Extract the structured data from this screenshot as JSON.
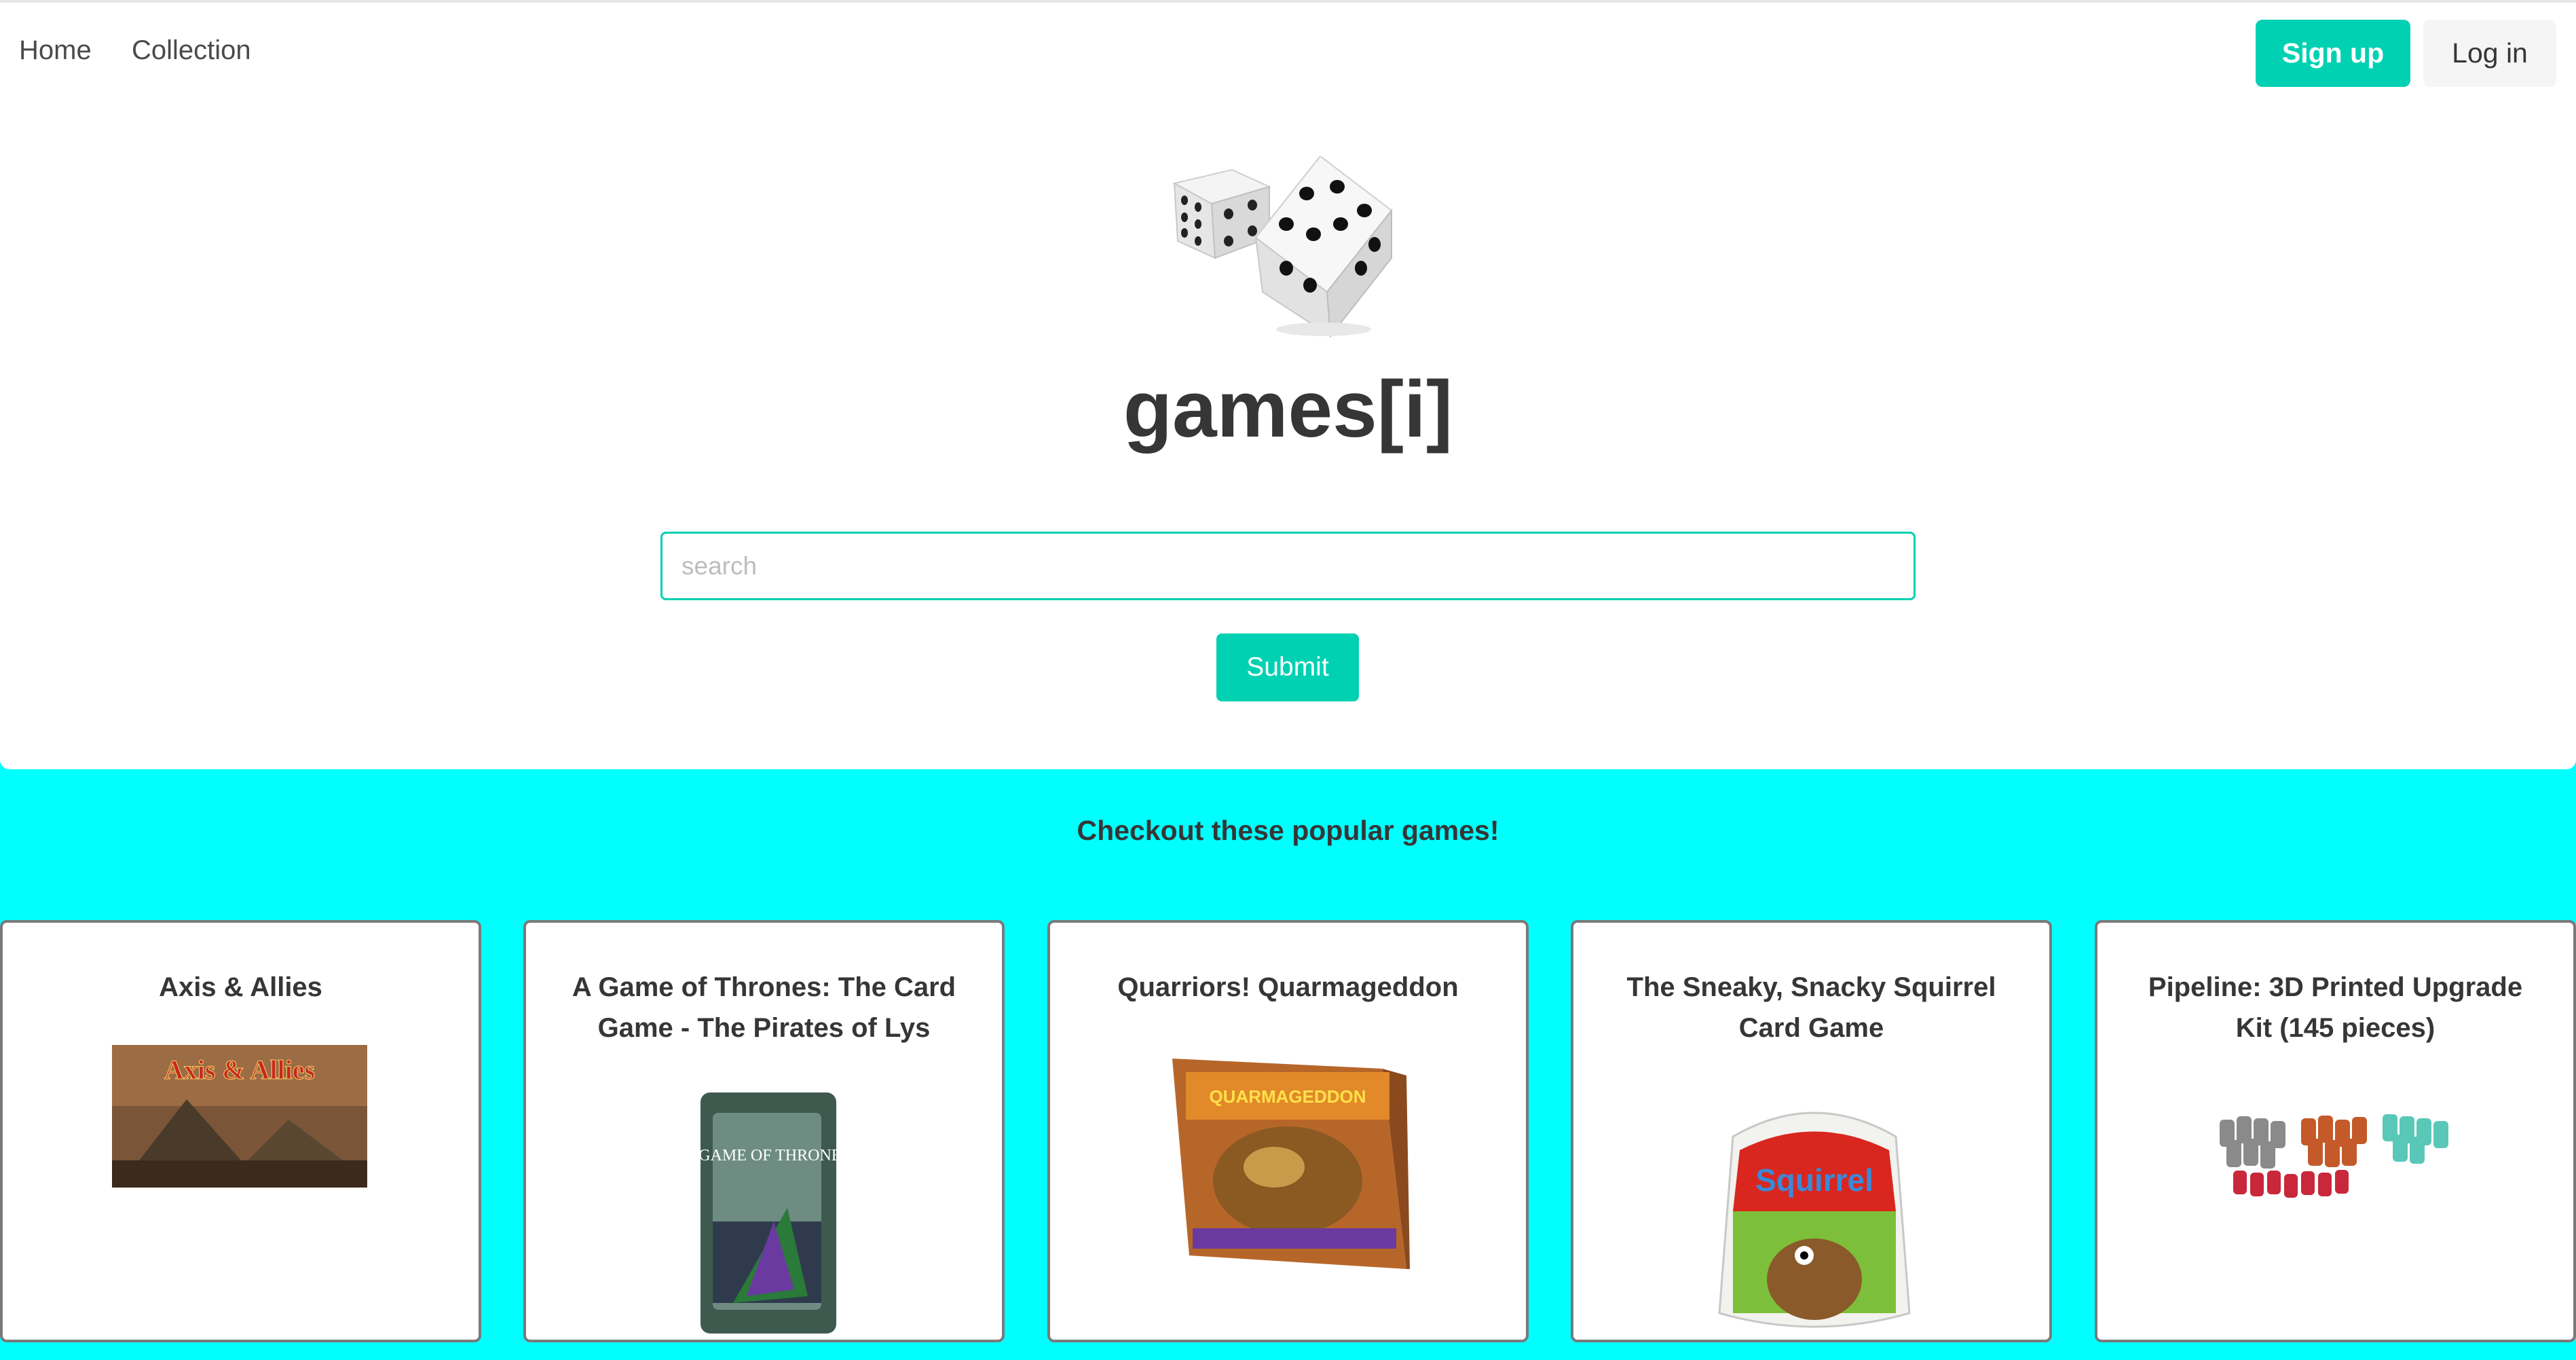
{
  "nav": {
    "home": "Home",
    "collection": "Collection",
    "signup": "Sign up",
    "login": "Log in"
  },
  "hero": {
    "title": "games[i]",
    "logo_icon": "dice-icon",
    "search_placeholder": "search",
    "search_value": "",
    "submit": "Submit"
  },
  "popular": {
    "heading": "Checkout these popular games!",
    "games": [
      {
        "title": "Axis & Allies",
        "image_text": "Axis & Allies"
      },
      {
        "title": "A Game of Thrones: The Card Game - The Pirates of Lys",
        "image_text": "A GAME OF THRONES"
      },
      {
        "title": "Quarriors! Quarmageddon",
        "image_text": "QUARMAGEDDON"
      },
      {
        "title": "The Sneaky, Snacky Squirrel Card Game",
        "image_text": "Squirrel"
      },
      {
        "title": "Pipeline: 3D Printed Upgrade Kit (145 pieces)",
        "image_text": ""
      }
    ]
  },
  "colors": {
    "primary": "#00D1B2",
    "background": "#00FFFF",
    "text": "#363636",
    "card_border": "#7a7a7a"
  }
}
